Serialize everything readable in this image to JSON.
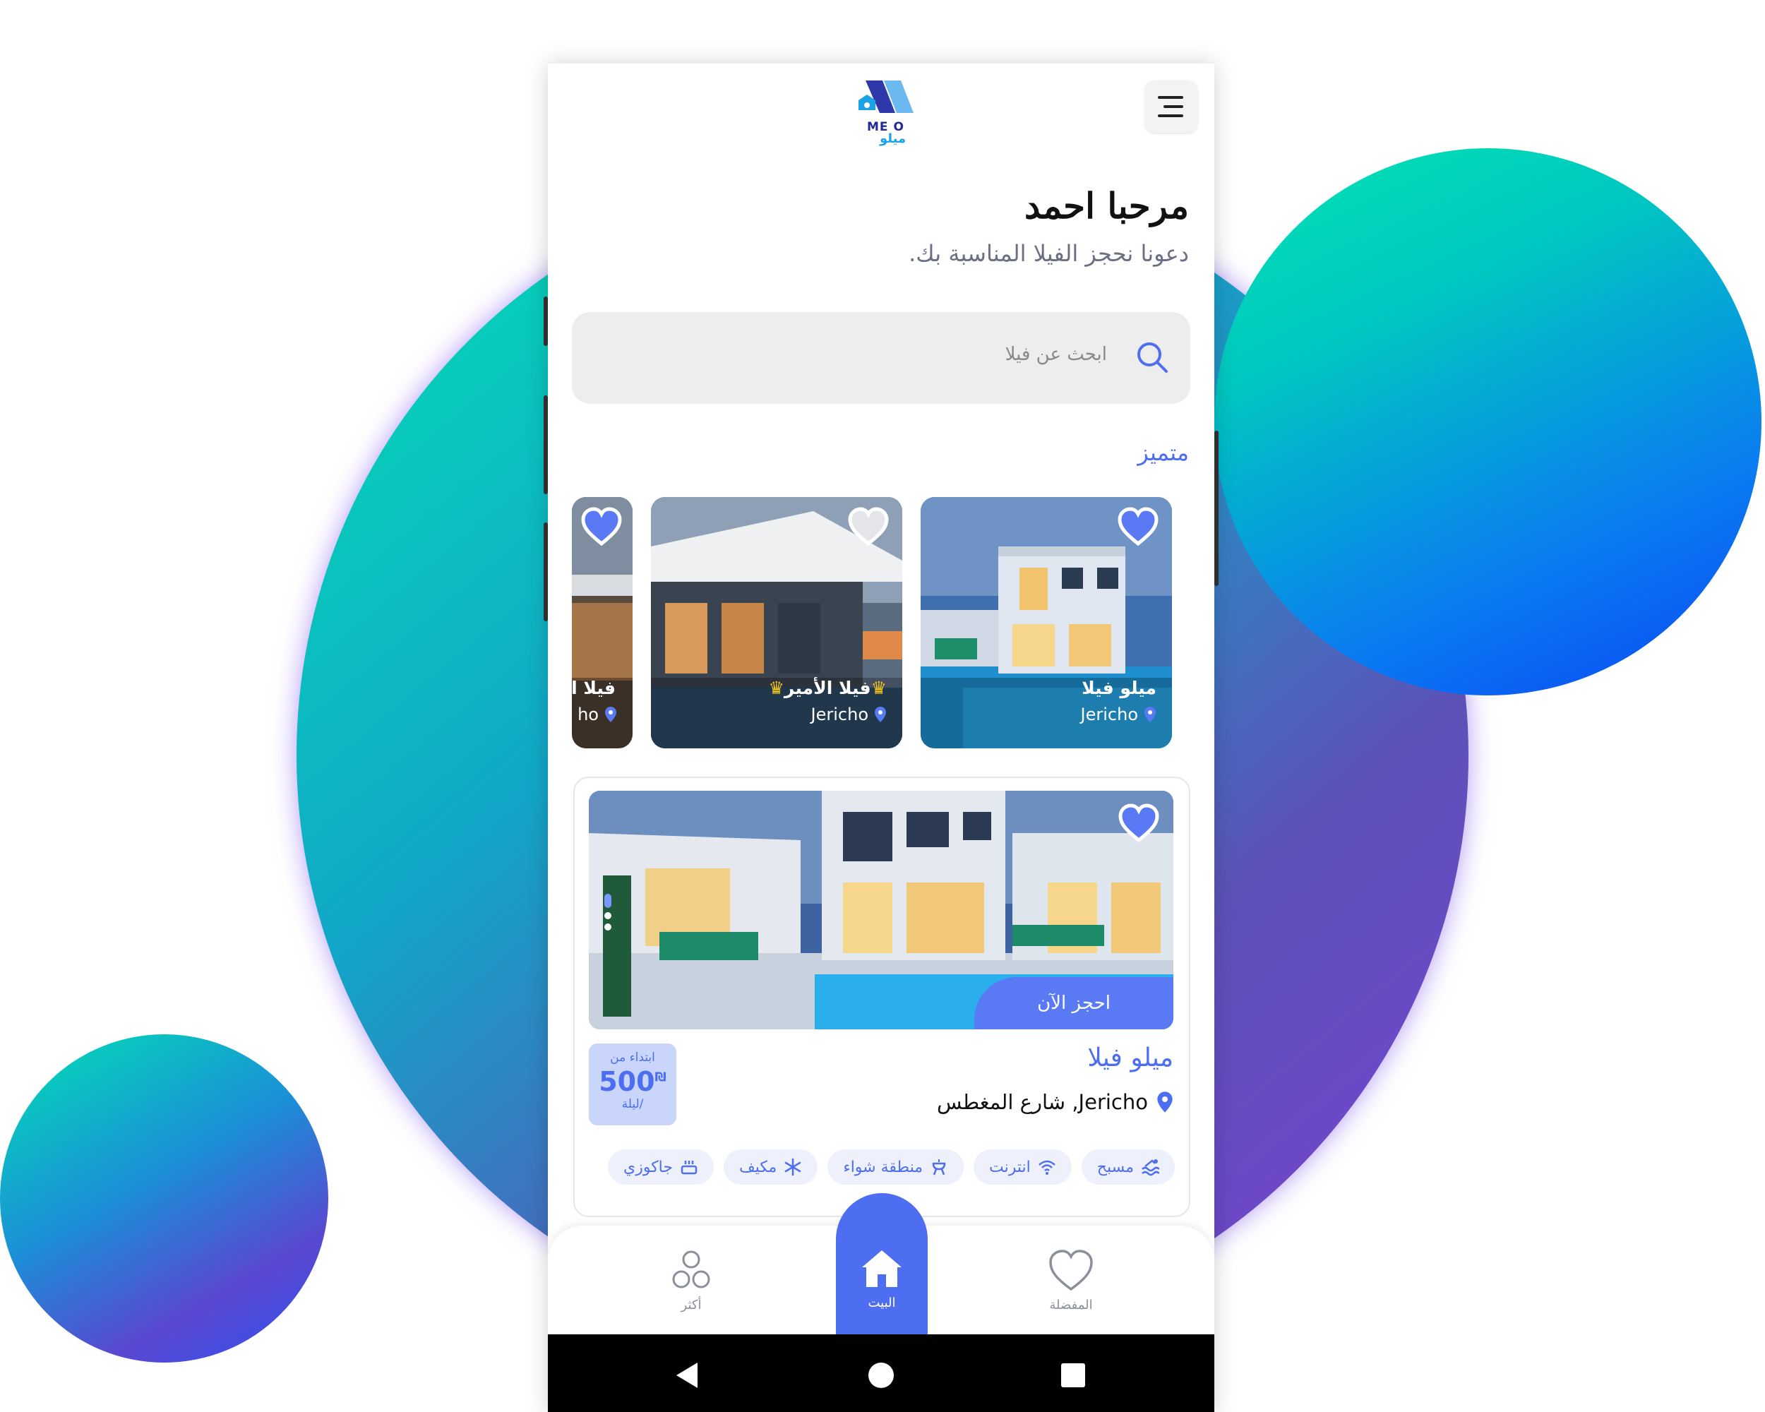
{
  "app": {
    "logo_en": "ME O",
    "logo_ar": "ميلو"
  },
  "header": {
    "greeting": "مرحبا احمد",
    "subtitle": "دعونا نحجز الفيلا المناسبة بك."
  },
  "search": {
    "placeholder": "ابحث عن فيلا"
  },
  "featured": {
    "title": "متميز",
    "items": [
      {
        "name": "ميلو فيلا",
        "location": "Jericho",
        "crowns": false
      },
      {
        "name": "فيلا الأمير",
        "location": "Jericho",
        "crowns": true
      },
      {
        "name": "فيلا ا",
        "location": "ho",
        "crowns": false
      }
    ]
  },
  "main_listing": {
    "name": "ميلو فيلا",
    "address": "Jericho, شارع المغطس",
    "book_label": "احجز الآن",
    "price_from": "ابتداء من",
    "price_value": "500",
    "currency": "₪",
    "price_unit": "/ليلة",
    "amenities": [
      {
        "label": "مسبح",
        "icon": "pool-icon"
      },
      {
        "label": "انترنت",
        "icon": "wifi-icon"
      },
      {
        "label": "منطقة شواء",
        "icon": "bbq-icon"
      },
      {
        "label": "مكيف",
        "icon": "snowflake-icon"
      },
      {
        "label": "جاكوزي",
        "icon": "jacuzzi-icon"
      }
    ]
  },
  "bottom_nav": {
    "more": "أكثر",
    "home": "البيت",
    "favorites": "المفضلة"
  },
  "colors": {
    "accent": "#4e6ef2",
    "price_bg": "#c9d5fb"
  }
}
